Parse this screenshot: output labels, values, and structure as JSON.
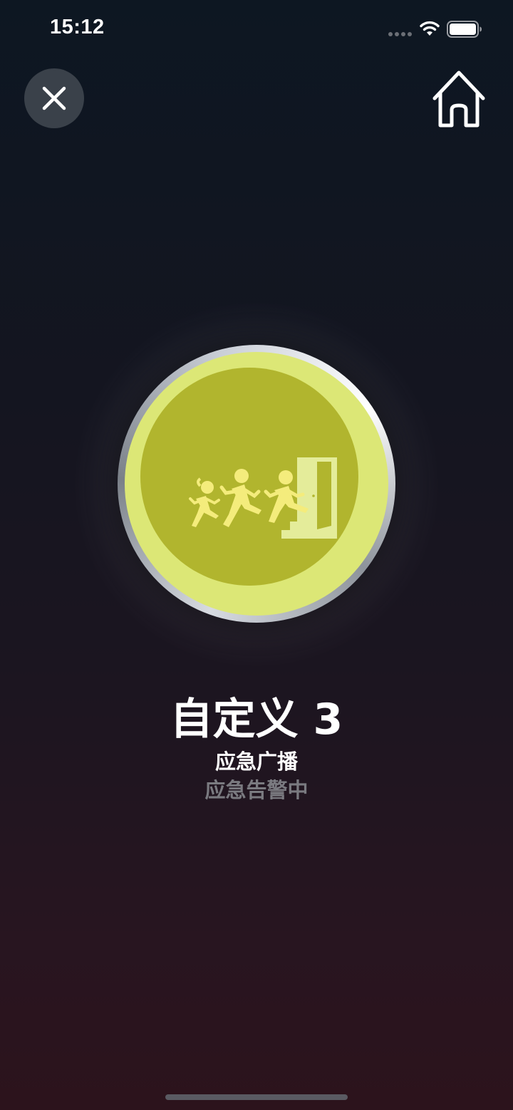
{
  "status_bar": {
    "time": "15:12",
    "signal_icon": "cellular-signal-icon",
    "wifi_icon": "wifi-icon",
    "battery_icon": "battery-full-icon"
  },
  "toolbar": {
    "close_icon": "close-icon",
    "home_icon": "home-icon"
  },
  "alarm": {
    "icon": "evacuation-icon",
    "ring_color": "#dce776",
    "core_color": "#b1b52e",
    "icon_color": "#f4ec7c"
  },
  "scene": {
    "title": "自定义 3",
    "type": "应急广播",
    "status": "应急告警中"
  }
}
